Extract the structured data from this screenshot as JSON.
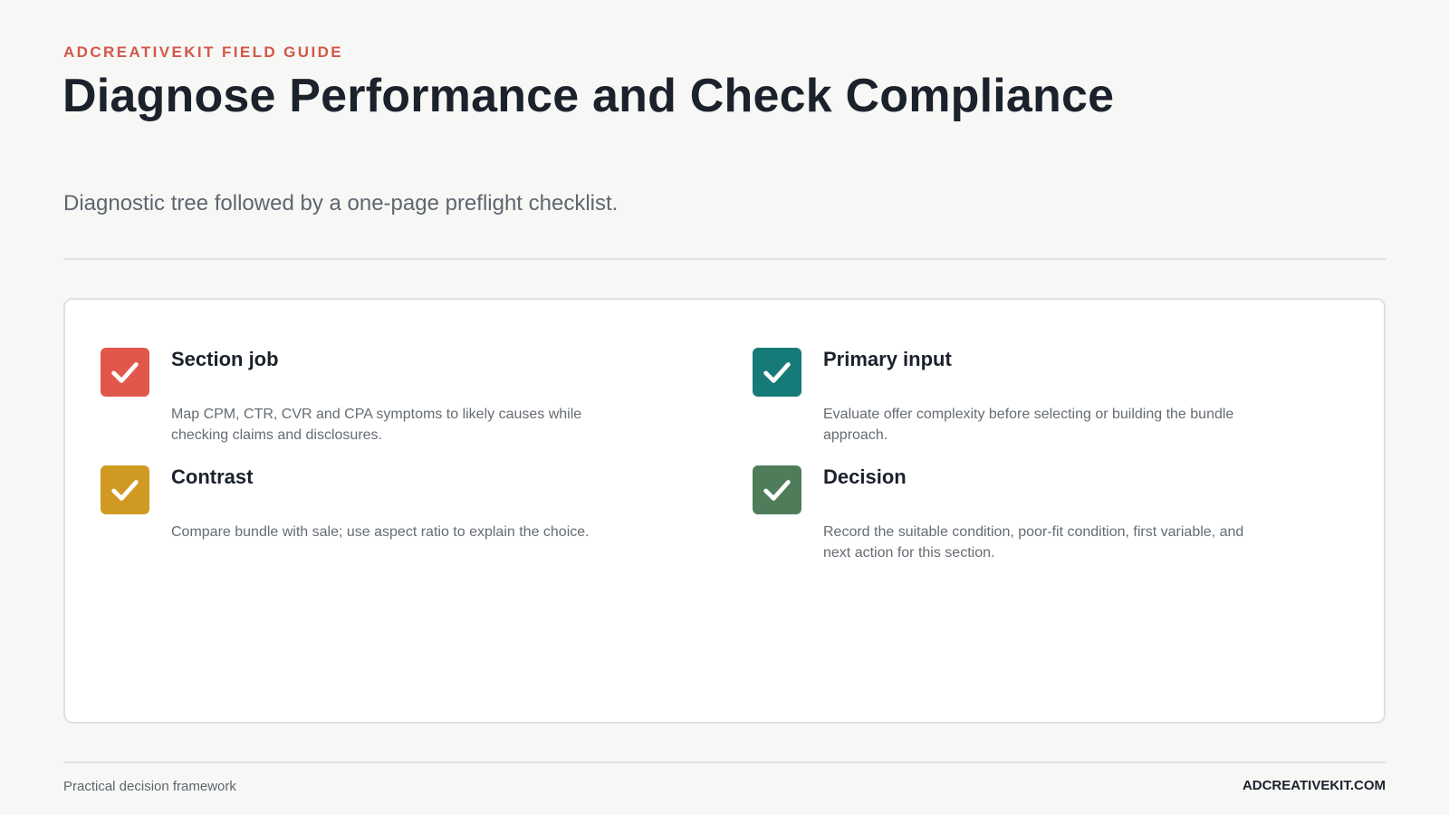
{
  "header": {
    "eyebrow": "ADCREATIVEKIT FIELD GUIDE",
    "title": "Diagnose Performance and Check Compliance",
    "subtitle": "Diagnostic tree followed by a one-page preflight checklist."
  },
  "checklist": {
    "items": [
      {
        "heading": "Section job",
        "body": "Map CPM, CTR, CVR and CPA symptoms to likely causes while checking claims and disclosures.",
        "icon": "check-icon",
        "color": "#e2574c"
      },
      {
        "heading": "Primary input",
        "body": "Evaluate offer complexity before selecting or building the bundle approach.",
        "icon": "check-icon",
        "color": "#167a78"
      },
      {
        "heading": "Contrast",
        "body": "Compare bundle with sale; use aspect ratio to explain the choice.",
        "icon": "check-icon",
        "color": "#d09a22"
      },
      {
        "heading": "Decision",
        "body": "Record the suitable condition, poor-fit condition, first variable, and next action for this section.",
        "icon": "check-icon",
        "color": "#4f7d5a"
      }
    ]
  },
  "footer": {
    "left": "Practical decision framework",
    "right": "ADCREATIVEKIT.COM"
  }
}
